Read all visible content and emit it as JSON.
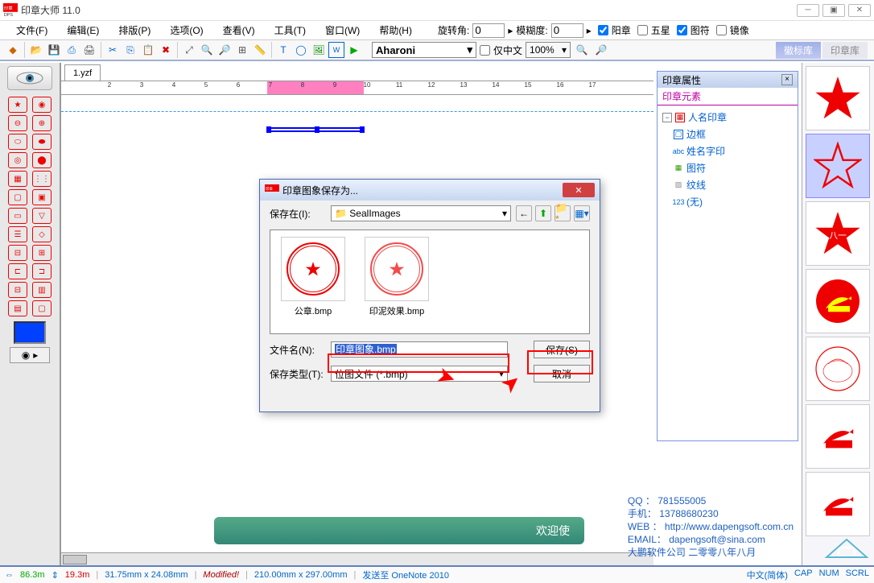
{
  "app": {
    "title": "印章大师 11.0"
  },
  "menus": [
    "文件(F)",
    "编辑(E)",
    "排版(P)",
    "选项(O)",
    "查看(V)",
    "工具(T)",
    "窗口(W)",
    "帮助(H)"
  ],
  "params": {
    "rotate_label": "旋转角:",
    "rotate_value": "0",
    "blur_label": "模糊度:",
    "blur_value": "0",
    "cb_yang": "阳章",
    "cb_star": "五星",
    "cb_symbol": "图符",
    "cb_mirror": "镜像",
    "cb_yang_checked": true,
    "cb_star_checked": false,
    "cb_symbol_checked": true,
    "cb_mirror_checked": false
  },
  "font": {
    "name": "Aharoni",
    "cn_only_label": "仅中文",
    "cn_only_checked": false,
    "zoom": "100%"
  },
  "right_tabs": {
    "active": "徽标库",
    "inactive": "印章库"
  },
  "doc_tab": "1.yzf",
  "ruler_marks": [
    "2",
    "3",
    "4",
    "5",
    "6",
    "7",
    "8",
    "9",
    "10",
    "11",
    "12",
    "13",
    "14",
    "15",
    "16",
    "17"
  ],
  "rpanel": {
    "title": "印章属性",
    "section": "印章元素",
    "root": "人名印章",
    "children": [
      "边框",
      "姓名字印",
      "图符",
      "纹线",
      "(无)"
    ]
  },
  "dialog": {
    "title": "印章图象保存为...",
    "savein_label": "保存在(I):",
    "folder": "SealImages",
    "files": [
      "公章.bmp",
      "印泥效果.bmp"
    ],
    "filename_label": "文件名(N):",
    "filename_value": "印章图象.bmp",
    "filetype_label": "保存类型(T):",
    "filetype_value": "位图文件 (*.bmp)",
    "save_btn": "保存(S)",
    "cancel_btn": "取消"
  },
  "info": {
    "qq": "QQ ： 781555005",
    "phone": "手机： 13788680230",
    "web": "WEB ： http://www.dapengsoft.com.cn",
    "email": "EMAIL： dapengsoft@sina.com",
    "company": "大鹏软件公司  二零零八年八月"
  },
  "status": {
    "x": "86.3m",
    "y": "19.3m",
    "size1": "31.75mm x 24.08mm",
    "modified": "Modified!",
    "size2": "210.00mm x 297.00mm",
    "send": "发送至 OneNote 2010",
    "lang": "中文(简体)",
    "caps": "CAP",
    "num": "NUM",
    "scrl": "SCRL"
  }
}
